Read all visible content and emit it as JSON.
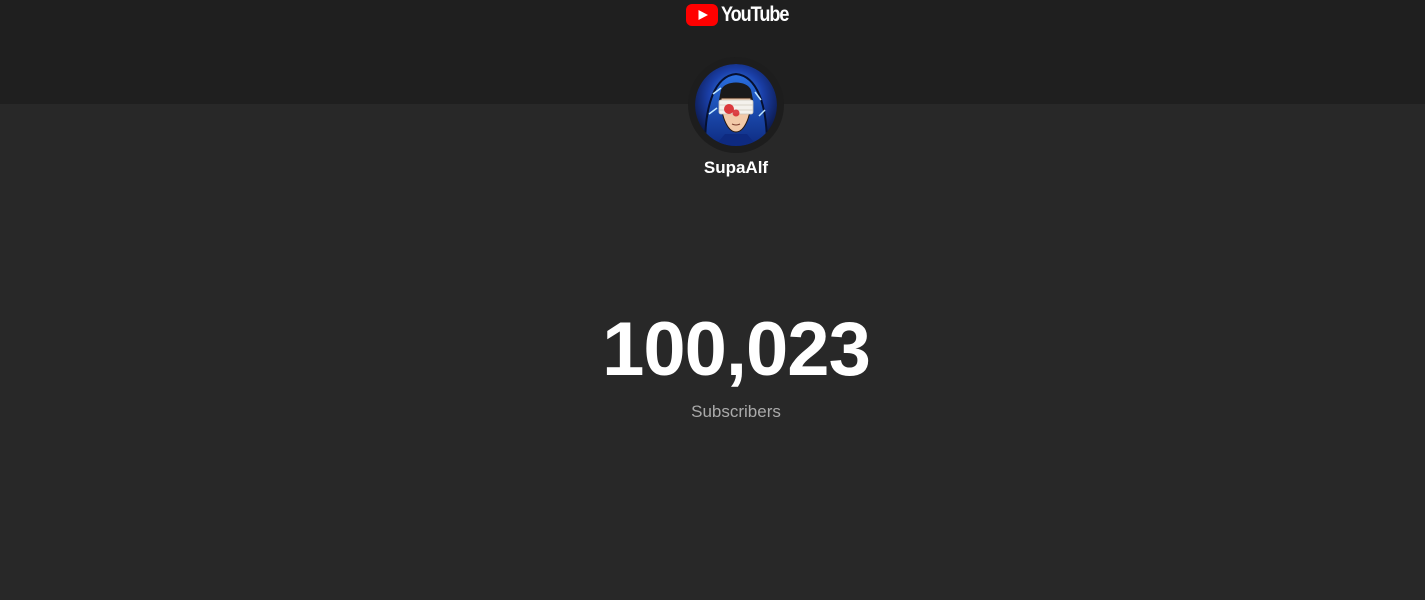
{
  "header": {
    "logo_text": "YouTube"
  },
  "channel": {
    "name": "SupaAlf"
  },
  "stats": {
    "subscriber_count": "100,023",
    "subscriber_label": "Subscribers"
  },
  "colors": {
    "brand_red": "#ff0000",
    "background": "#282828",
    "header_band": "#1f1f1f",
    "text_primary": "#ffffff",
    "text_secondary": "#aaaaaa"
  }
}
